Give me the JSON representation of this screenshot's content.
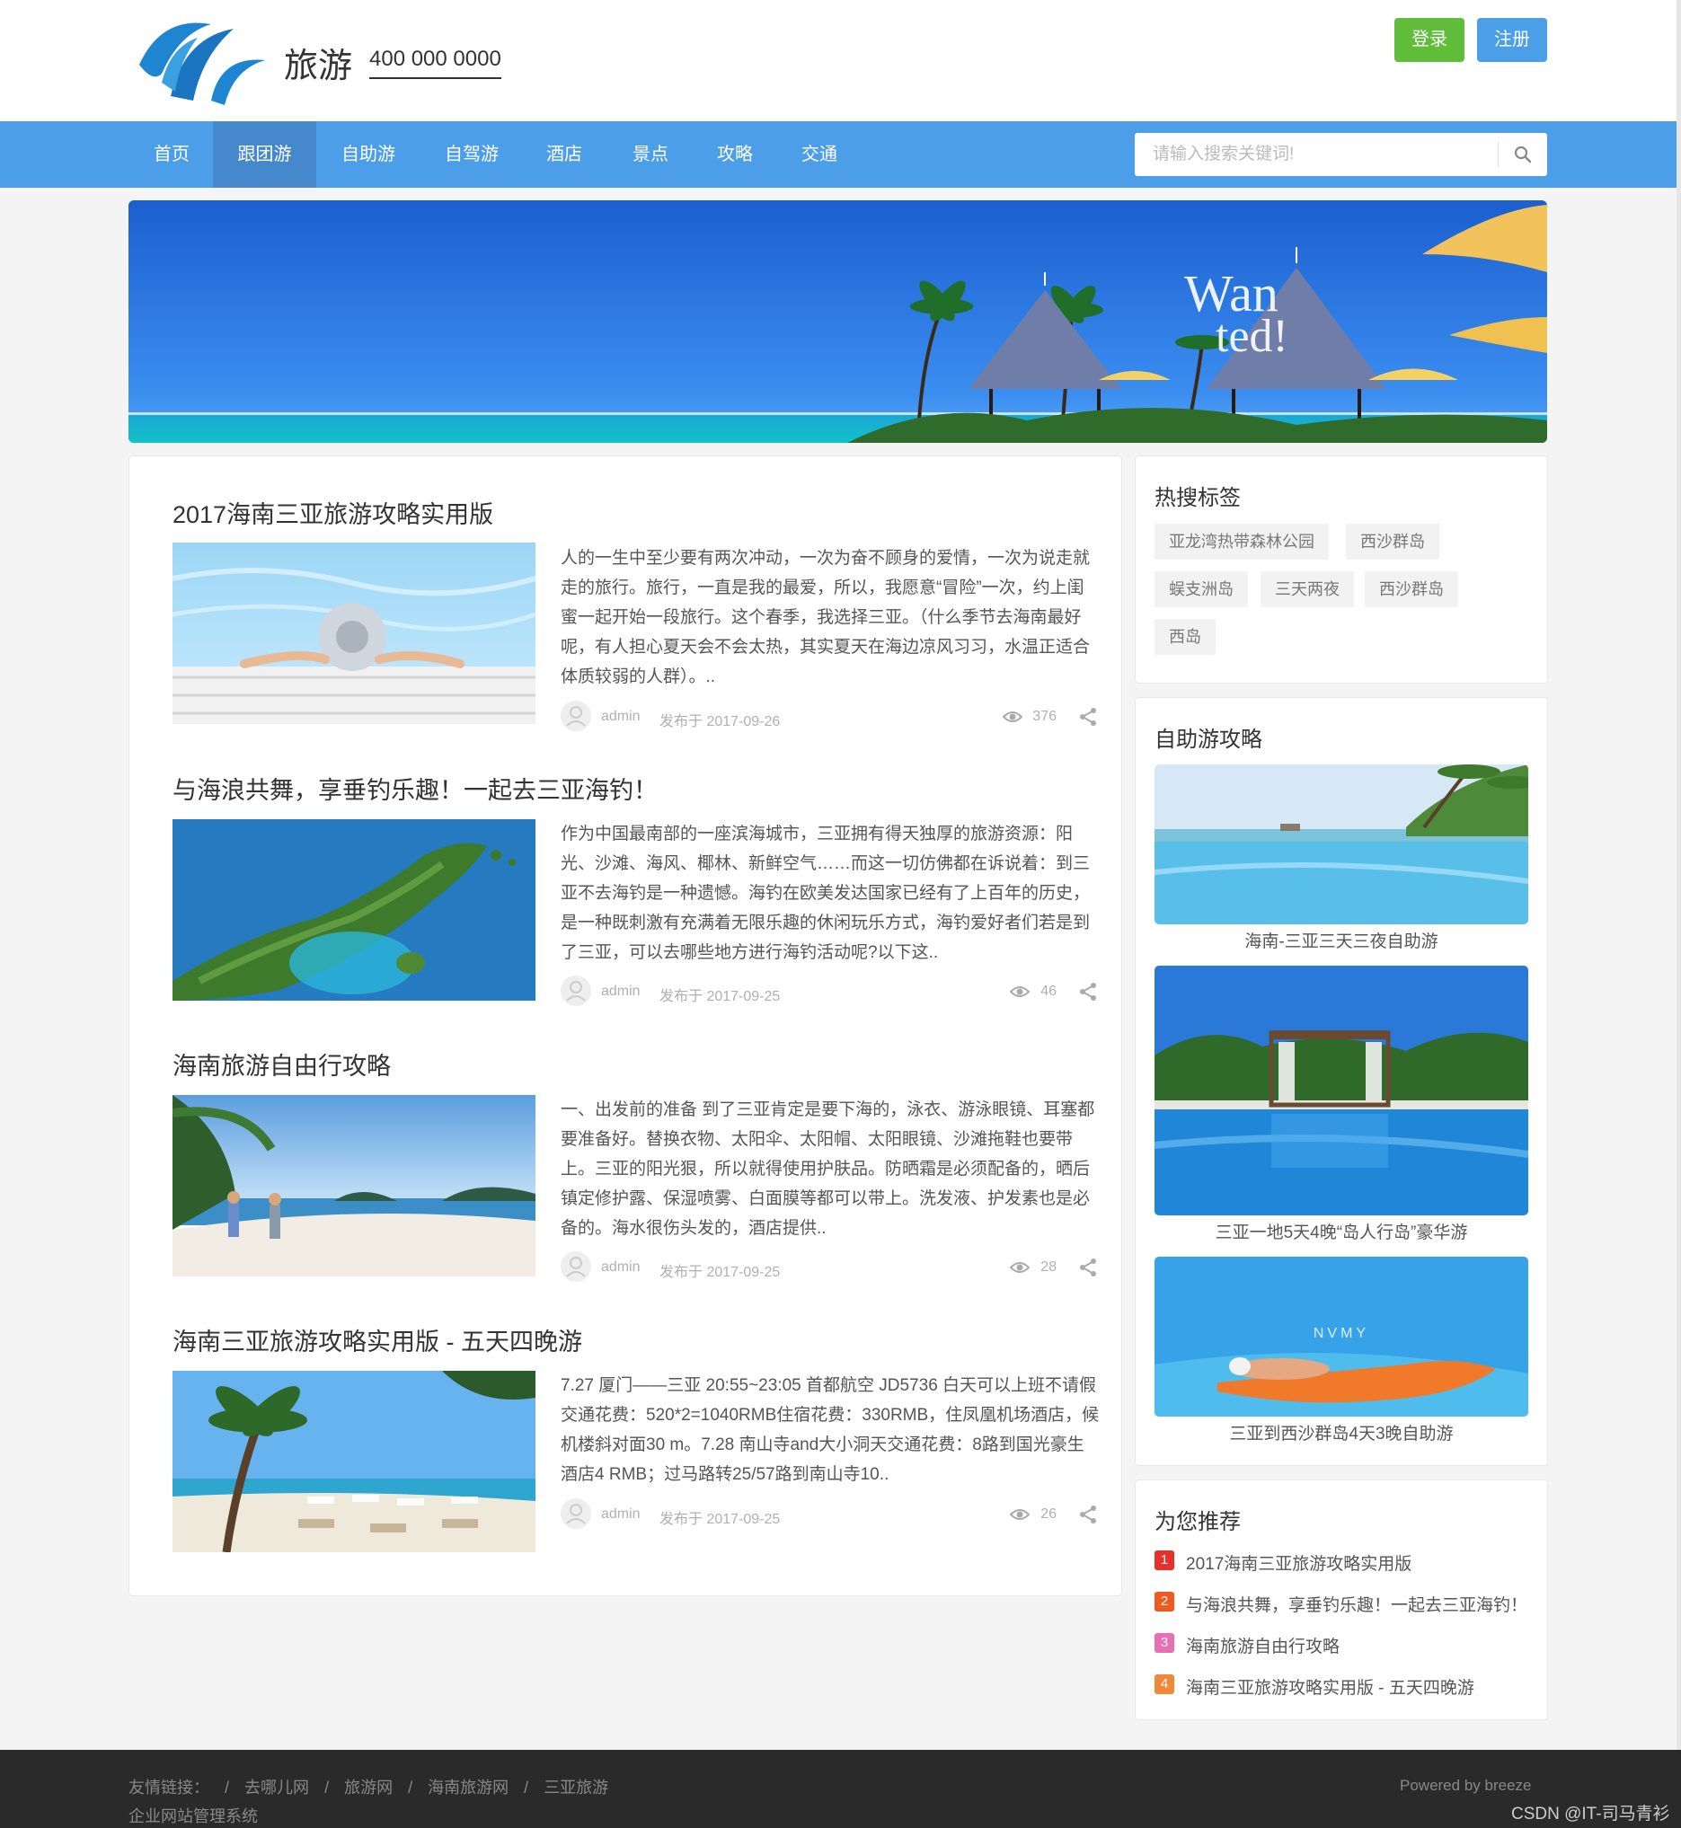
{
  "header": {
    "brand": "旅游",
    "phone": "400 000 0000",
    "login_label": "登录",
    "register_label": "注册"
  },
  "nav": {
    "items": [
      "首页",
      "跟团游",
      "自助游",
      "自驾游",
      "酒店",
      "景点",
      "攻略",
      "交通"
    ],
    "active": "跟团游"
  },
  "search": {
    "placeholder": "请输入搜索关键词!"
  },
  "banner": {
    "text_line1": "Wan",
    "text_line2": "ted!"
  },
  "articles": [
    {
      "title": "2017海南三亚旅游攻略实用版",
      "excerpt": "人的一生中至少要有两次冲动，一次为奋不顾身的爱情，一次为说走就走的旅行。旅行，一直是我的最爱，所以，我愿意“冒险”一次，约上闺蜜一起开始一段旅行。这个春季，我选择三亚。（什么季节去海南最好呢，有人担心夏天会不会太热，其实夏天在海边凉风习习，水温正适合体质较弱的人群）。..",
      "author": "admin",
      "date": "发布于 2017-09-26",
      "views": "376"
    },
    {
      "title": "与海浪共舞，享垂钓乐趣！一起去三亚海钓！",
      "excerpt": "作为中国最南部的一座滨海城市，三亚拥有得天独厚的旅游资源：阳光、沙滩、海风、椰林、新鲜空气……而这一切仿佛都在诉说着：到三亚不去海钓是一种遗憾。海钓在欧美发达国家已经有了上百年的历史，是一种既刺激有充满着无限乐趣的休闲玩乐方式，海钓爱好者们若是到了三亚，可以去哪些地方进行海钓活动呢?以下这..",
      "author": "admin",
      "date": "发布于 2017-09-25",
      "views": "46"
    },
    {
      "title": "海南旅游自由行攻略",
      "excerpt": "一、出发前的准备 到了三亚肯定是要下海的，泳衣、游泳眼镜、耳塞都要准备好。替换衣物、太阳伞、太阳帽、太阳眼镜、沙滩拖鞋也要带上。三亚的阳光狠，所以就得使用护肤品。防晒霜是必须配备的，晒后镇定修护露、保湿喷雾、白面膜等都可以带上。洗发液、护发素也是必备的。海水很伤头发的，酒店提供..",
      "author": "admin",
      "date": "发布于 2017-09-25",
      "views": "28"
    },
    {
      "title": "海南三亚旅游攻略实用版 - 五天四晚游",
      "excerpt": "7.27 厦门——三亚 20:55~23:05 首都航空 JD5736 白天可以上班不请假交通花费：520*2=1040RMB住宿花费：330RMB，住凤凰机场酒店，候机楼斜对面30 m。7.28 南山寺and大小洞天交通花费：8路到国光豪生酒店4 RMB；过马路转25/57路到南山寺10..",
      "author": "admin",
      "date": "发布于 2017-09-25",
      "views": "26"
    }
  ],
  "hot_tags": {
    "title": "热搜标签",
    "tags": [
      "亚龙湾热带森林公园",
      "西沙群岛",
      "蜈支洲岛",
      "三天两夜",
      "西沙群岛",
      "西岛"
    ]
  },
  "guides": {
    "title": "自助游攻略",
    "items": [
      {
        "caption": "海南-三亚三天三夜自助游"
      },
      {
        "caption": "三亚一地5天4晚“岛人行岛”豪华游"
      },
      {
        "caption": "三亚到西沙群岛4天3晚自助游",
        "image_text": "NVMY"
      }
    ]
  },
  "recommend": {
    "title": "为您推荐",
    "items": [
      {
        "num": "1",
        "text": "2017海南三亚旅游攻略实用版",
        "color": "#e8302a"
      },
      {
        "num": "2",
        "text": "与海浪共舞，享垂钓乐趣！一起去三亚海钓！",
        "color": "#f05a1e"
      },
      {
        "num": "3",
        "text": "海南旅游自由行攻略",
        "color": "#e86fb3"
      },
      {
        "num": "4",
        "text": "海南三亚旅游攻略实用版 - 五天四晚游",
        "color": "#f0883a"
      }
    ]
  },
  "footer": {
    "friend_label": "友情链接：",
    "links": [
      "去哪儿网",
      "旅游网",
      "海南旅游网",
      "三亚旅游"
    ],
    "sep": "/",
    "system": "企业网站管理系统",
    "powered": "Powered by breeze",
    "watermark": "CSDN @IT-司马青衫"
  },
  "colors": {
    "nav_bg": "#4d9ee8",
    "nav_active": "#4589cc",
    "login": "#5fbd39",
    "register": "#4a9fe6",
    "footer_bg": "#2a2a2a"
  }
}
